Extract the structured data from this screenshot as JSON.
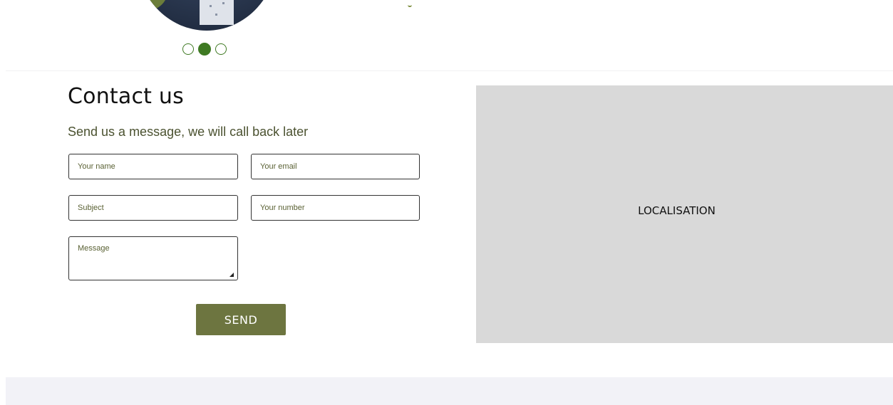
{
  "carousel": {
    "dots": [
      {
        "state": "inactive"
      },
      {
        "state": "active"
      },
      {
        "state": "inactive"
      }
    ],
    "accent_color": "#3f7a23"
  },
  "contact": {
    "title": "Contact us",
    "subtitle": "Send us a message, we will call back later",
    "fields": {
      "name_placeholder": "Your name",
      "email_placeholder": "Your email",
      "subject_placeholder": "Subject",
      "number_placeholder": "Your number",
      "message_placeholder": "Message"
    },
    "send_label": "SEND",
    "send_color": "#6d7540"
  },
  "map": {
    "label": "LOCALISATION",
    "background": "#d9d9d9"
  },
  "footer": {
    "background": "#f2f2f7"
  }
}
